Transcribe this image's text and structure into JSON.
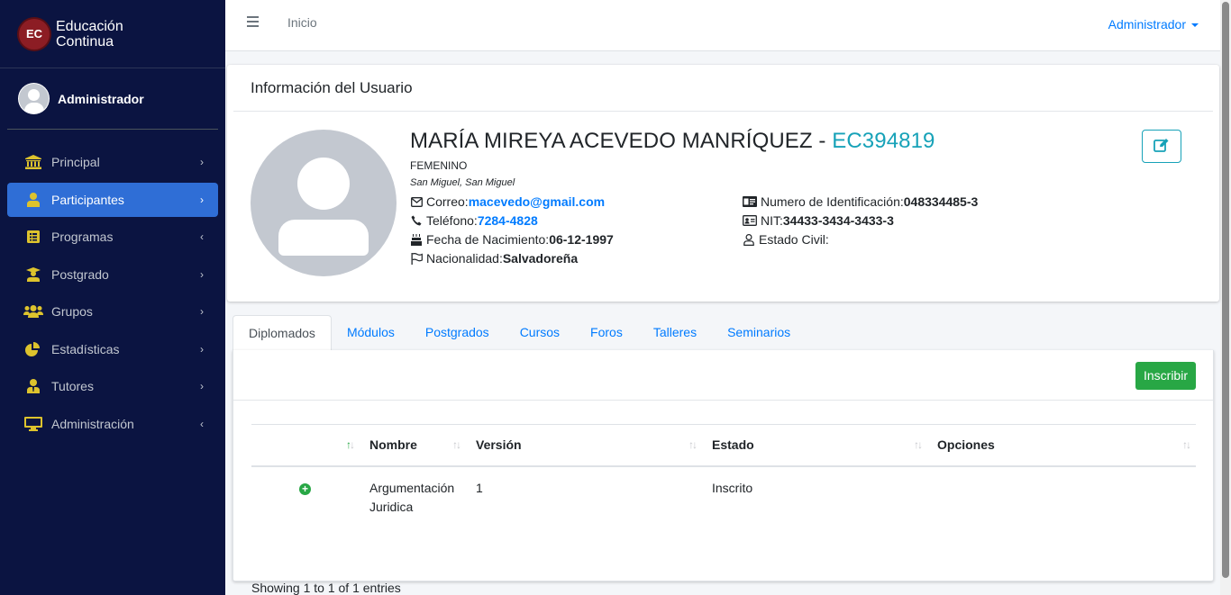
{
  "brand": {
    "logo_text": "EC",
    "line1": "Educación",
    "line2": "Continua"
  },
  "user": {
    "name": "Administrador"
  },
  "nav": [
    {
      "label": "Principal",
      "icon": "bank-icon",
      "arrow": "›",
      "active": false
    },
    {
      "label": "Participantes",
      "icon": "user-icon",
      "arrow": "›",
      "active": true
    },
    {
      "label": "Programas",
      "icon": "list-icon",
      "arrow": "‹",
      "active": false
    },
    {
      "label": "Postgrado",
      "icon": "graduate-icon",
      "arrow": "›",
      "active": false
    },
    {
      "label": "Grupos",
      "icon": "users-icon",
      "arrow": "›",
      "active": false
    },
    {
      "label": "Estadísticas",
      "icon": "pie-chart-icon",
      "arrow": "›",
      "active": false
    },
    {
      "label": "Tutores",
      "icon": "tutor-icon",
      "arrow": "›",
      "active": false
    },
    {
      "label": "Administración",
      "icon": "desktop-icon",
      "arrow": "‹",
      "active": false
    }
  ],
  "header": {
    "home": "Inicio",
    "admin_menu": "Administrador"
  },
  "profile": {
    "card_title": "Información del Usuario",
    "name": "MARÍA MIREYA ACEVEDO MANRÍQUEZ - ",
    "code": "EC394819",
    "gender": "FEMENINO",
    "location": "San Miguel, San Miguel",
    "email_label": "Correo: ",
    "email": "macevedo@gmail.com",
    "phone_label": "Teléfono: ",
    "phone": "7284-4828",
    "birth_label": "Fecha de Nacimiento: ",
    "birth": "06-12-1997",
    "nationality_label": "Nacionalidad: ",
    "nationality": "Salvadoreña",
    "id_label": "Numero de Identificación: ",
    "id_number": "048334485-3",
    "nit_label": "NIT: ",
    "nit": "34433-3434-3433-3",
    "civil_label": "Estado Civil:",
    "civil": ""
  },
  "tabs": [
    "Diplomados",
    "Módulos",
    "Postgrados",
    "Cursos",
    "Foros",
    "Talleres",
    "Seminarios"
  ],
  "table": {
    "enroll_button": "Inscribir",
    "columns": [
      "",
      "Nombre",
      "Versión",
      "Estado",
      "Opciones"
    ],
    "rows": [
      {
        "nombre": "Argumentación Juridica",
        "version": "1",
        "estado": "Inscrito",
        "opciones": ""
      }
    ],
    "info": "Showing 1 to 1 of 1 entries"
  },
  "colors": {
    "sidebar": "#0b1441",
    "active": "#2f6ed6",
    "icon": "#ddc32d",
    "link": "#007bff",
    "teal": "#17a2b8",
    "success": "#28a745"
  }
}
